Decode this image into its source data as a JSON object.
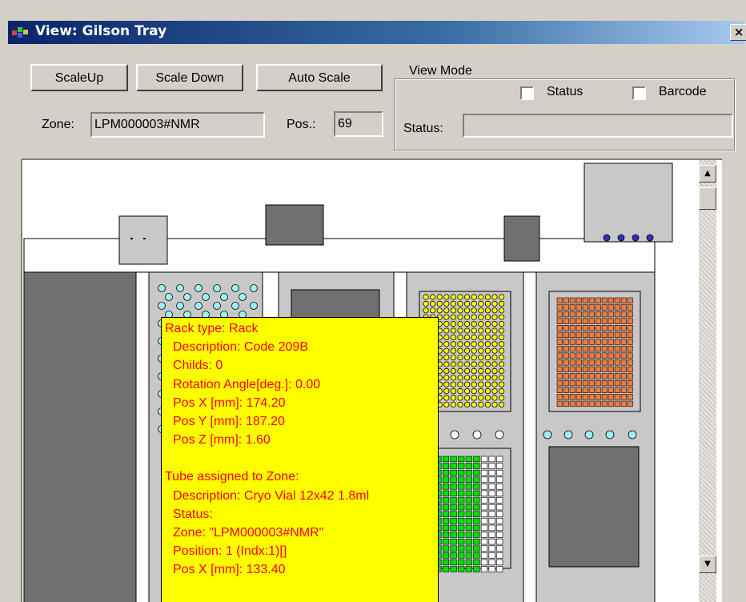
{
  "window": {
    "title": "View: Gilson Tray",
    "close_glyph": "×",
    "title_icon": "app-window-icon",
    "titlebar_colors": [
      "#0a246a",
      "#a6caf0"
    ]
  },
  "toolbar": {
    "scale_up_label": "ScaleUp",
    "scale_down_label": "Scale Down",
    "auto_scale_label": "Auto Scale"
  },
  "zone": {
    "label": "Zone:",
    "value": "LPM000003#NMR"
  },
  "pos": {
    "label": "Pos.:",
    "value": "69"
  },
  "view_mode": {
    "legend": "View Mode",
    "status_checkbox_label": "Status",
    "status_checked": false,
    "barcode_checkbox_label": "Barcode",
    "barcode_checked": false,
    "status_label": "Status:",
    "status_value": ""
  },
  "tooltip": {
    "rack_header": "Rack type: Rack",
    "rack_lines": [
      "Description:  Code 209B",
      "Childs:  0",
      "Rotation Angle[deg.]:  0.00",
      "Pos X [mm]: 174.20",
      "Pos Y [mm]: 187.20",
      "Pos Z [mm]: 1.60"
    ],
    "tube_header": "Tube assigned to Zone:",
    "tube_lines": [
      "Description: Cryo Vial  12x42  1.8ml",
      "Status:",
      "Zone: \"LPM000003#NMR\"",
      "Position: 1 (Indx:1)[]",
      "Pos X [mm]: 133.40"
    ]
  },
  "colors": {
    "window_bg": "#d4d0c8",
    "tooltip_bg": "#ffff00",
    "tooltip_text": "#ff0000",
    "rack_dark": "#707070",
    "rack_light": "#c8c8c8",
    "well_cyan": "#9ff0f0",
    "well_yellow": "#ffff00",
    "well_orange": "#f07a3c",
    "well_green": "#00e000",
    "well_blue": "#3030c0"
  },
  "scrollbar": {
    "up_glyph": "▲",
    "down_glyph": "▼"
  }
}
